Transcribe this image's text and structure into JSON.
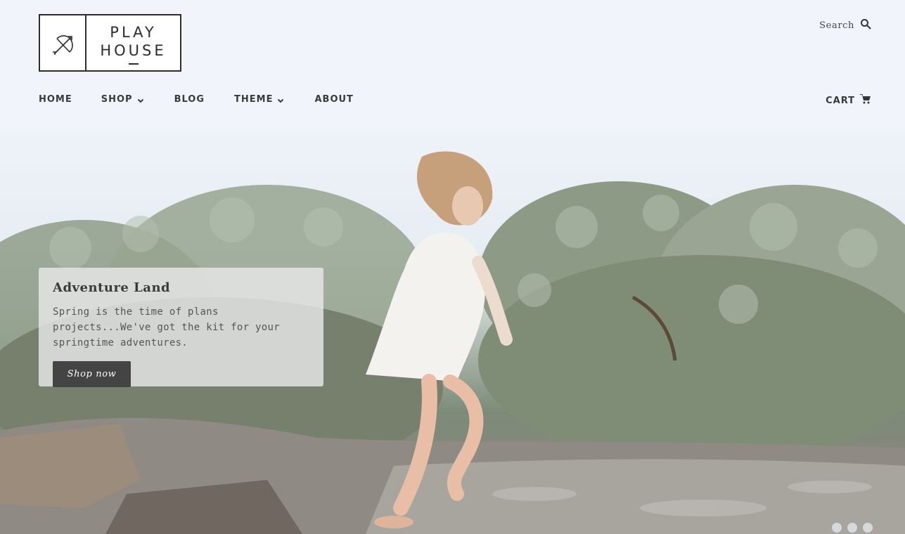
{
  "logo": {
    "line1": "PLAY",
    "line2": "HOUSE",
    "icon": "bow-and-arrow-icon"
  },
  "search": {
    "label": "Search",
    "icon": "search-icon"
  },
  "nav": {
    "items": [
      {
        "label": "HOME",
        "has_dropdown": false
      },
      {
        "label": "SHOP",
        "has_dropdown": true
      },
      {
        "label": "BLOG",
        "has_dropdown": false
      },
      {
        "label": "THEME",
        "has_dropdown": true
      },
      {
        "label": "ABOUT",
        "has_dropdown": false
      }
    ]
  },
  "cart": {
    "label": "CART",
    "icon": "cart-icon"
  },
  "hero": {
    "title": "Adventure Land",
    "text": "Spring is the time of plans projects...We've got the kit for your springtime adventures.",
    "button_label": "Shop now",
    "slide_count": 3,
    "active_slide": 1
  },
  "colors": {
    "text": "#3a3a3a",
    "button_bg": "#444444",
    "header_bg": "#f1f5fb"
  }
}
